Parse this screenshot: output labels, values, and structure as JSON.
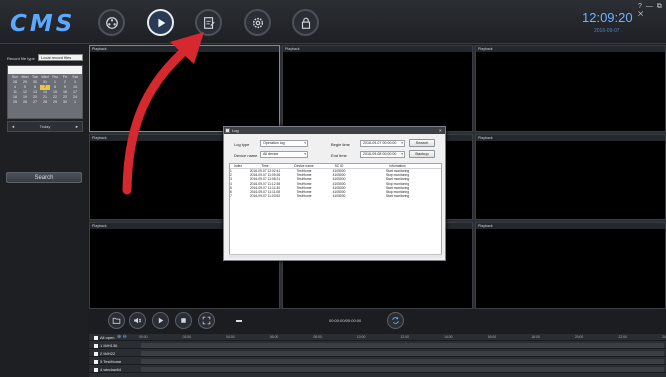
{
  "app": {
    "logo": "CMS",
    "clock": "12:09:20",
    "date": "2016-09-07",
    "window_controls": "? — ⧉ ✕"
  },
  "toolbar": {
    "buttons": [
      {
        "icon": "playback-reel-icon"
      },
      {
        "icon": "play-icon",
        "active": true
      },
      {
        "icon": "log-icon"
      },
      {
        "icon": "settings-icon"
      },
      {
        "icon": "lock-icon"
      }
    ]
  },
  "left": {
    "record_file_type_label": "Record file type",
    "record_file_type_value": "Local record files",
    "calendar": {
      "month": "",
      "weekdays": [
        "Sun",
        "Mon",
        "Tue",
        "Wed",
        "Thu",
        "Fri",
        "Sat"
      ],
      "days": [
        "28",
        "29",
        "30",
        "31",
        "1",
        "2",
        "3",
        "4",
        "5",
        "6",
        "7",
        "8",
        "9",
        "10",
        "11",
        "12",
        "13",
        "14",
        "15",
        "16",
        "17",
        "18",
        "19",
        "20",
        "21",
        "22",
        "23",
        "24",
        "25",
        "26",
        "27",
        "28",
        "29",
        "30",
        "1"
      ],
      "selected_day": "7"
    },
    "nav_prev": "◄",
    "today_label": "Today",
    "nav_next": "►",
    "search_label": "Search"
  },
  "panes": [
    "Playback",
    "Playback",
    "Playback",
    "Playback",
    "Playback",
    "Playback",
    "Playback",
    "Playback",
    "Playback"
  ],
  "playback": {
    "timecode": "00:00:00/00:00:00"
  },
  "timeline": {
    "ticks": [
      "00:00",
      "02:00",
      "04:00",
      "06:00",
      "08:00",
      "10:00",
      "12:00",
      "14:00",
      "16:00",
      "18:00",
      "20:00",
      "22:00",
      "24:00"
    ],
    "rows": [
      "All open",
      "1 IMH136",
      "2 IMH22",
      "3 TestHome",
      "4 window64"
    ]
  },
  "dialog": {
    "title": "Log",
    "close": "✕",
    "log_type_label": "Log type",
    "log_type_value": "Operation log",
    "device_name_label": "Device name",
    "device_name_value": "All device",
    "begin_time_label": "Begin time",
    "begin_time_value": "2016-09-07 00:00:00",
    "end_time_label": "End time",
    "end_time_value": "2016-09-08 00:00:00",
    "search_button": "Search",
    "backup_button": "Backup",
    "columns": [
      "Index",
      "Time",
      "Device name",
      "SC ID",
      "Information"
    ],
    "rows": [
      [
        "1",
        "2016-09-07 12:02:41",
        "TestHome",
        "4105000",
        "Start monitoring"
      ],
      [
        "2",
        "2016-09-07 11:09:26",
        "TestHome",
        "4105000",
        "Stop monitoring"
      ],
      [
        "3",
        "2016-09-07 11:08:21",
        "TestHome",
        "4105000",
        "Start monitoring"
      ],
      [
        "4",
        "2016-09-07 11:12:35",
        "TestHome",
        "4105000",
        "Stop monitoring"
      ],
      [
        "5",
        "2016-09-07 11:11:30",
        "TestHome",
        "4105000",
        "Start monitoring"
      ],
      [
        "6",
        "2016-09-07 11:11:08",
        "TestHome",
        "4105000",
        "Stop monitoring"
      ],
      [
        "7",
        "2016-09-07 11:03:52",
        "TestHome",
        "4105000",
        "Start monitoring"
      ]
    ]
  },
  "colors": {
    "accent": "#5aa9ff",
    "annotation_arrow": "#d6282f"
  }
}
